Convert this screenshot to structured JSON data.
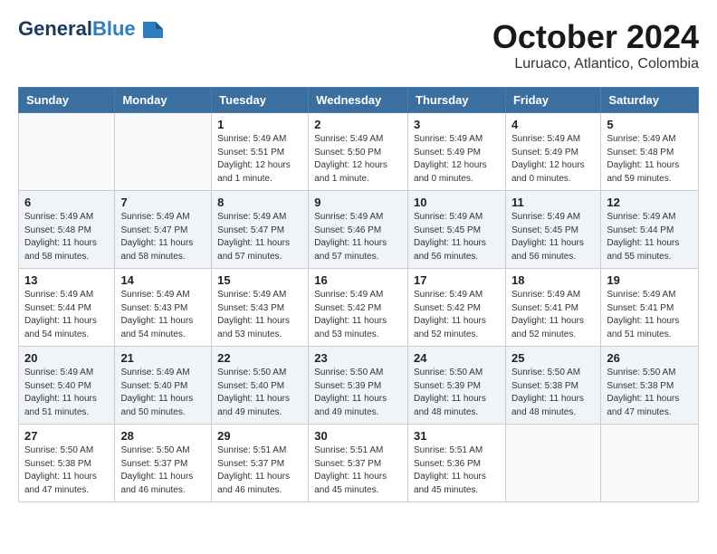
{
  "header": {
    "logo_line1": "General",
    "logo_line2": "Blue",
    "month": "October 2024",
    "location": "Luruaco, Atlantico, Colombia"
  },
  "weekdays": [
    "Sunday",
    "Monday",
    "Tuesday",
    "Wednesday",
    "Thursday",
    "Friday",
    "Saturday"
  ],
  "weeks": [
    [
      {
        "day": "",
        "info": ""
      },
      {
        "day": "",
        "info": ""
      },
      {
        "day": "1",
        "info": "Sunrise: 5:49 AM\nSunset: 5:51 PM\nDaylight: 12 hours\nand 1 minute."
      },
      {
        "day": "2",
        "info": "Sunrise: 5:49 AM\nSunset: 5:50 PM\nDaylight: 12 hours\nand 1 minute."
      },
      {
        "day": "3",
        "info": "Sunrise: 5:49 AM\nSunset: 5:49 PM\nDaylight: 12 hours\nand 0 minutes."
      },
      {
        "day": "4",
        "info": "Sunrise: 5:49 AM\nSunset: 5:49 PM\nDaylight: 12 hours\nand 0 minutes."
      },
      {
        "day": "5",
        "info": "Sunrise: 5:49 AM\nSunset: 5:48 PM\nDaylight: 11 hours\nand 59 minutes."
      }
    ],
    [
      {
        "day": "6",
        "info": "Sunrise: 5:49 AM\nSunset: 5:48 PM\nDaylight: 11 hours\nand 58 minutes."
      },
      {
        "day": "7",
        "info": "Sunrise: 5:49 AM\nSunset: 5:47 PM\nDaylight: 11 hours\nand 58 minutes."
      },
      {
        "day": "8",
        "info": "Sunrise: 5:49 AM\nSunset: 5:47 PM\nDaylight: 11 hours\nand 57 minutes."
      },
      {
        "day": "9",
        "info": "Sunrise: 5:49 AM\nSunset: 5:46 PM\nDaylight: 11 hours\nand 57 minutes."
      },
      {
        "day": "10",
        "info": "Sunrise: 5:49 AM\nSunset: 5:45 PM\nDaylight: 11 hours\nand 56 minutes."
      },
      {
        "day": "11",
        "info": "Sunrise: 5:49 AM\nSunset: 5:45 PM\nDaylight: 11 hours\nand 56 minutes."
      },
      {
        "day": "12",
        "info": "Sunrise: 5:49 AM\nSunset: 5:44 PM\nDaylight: 11 hours\nand 55 minutes."
      }
    ],
    [
      {
        "day": "13",
        "info": "Sunrise: 5:49 AM\nSunset: 5:44 PM\nDaylight: 11 hours\nand 54 minutes."
      },
      {
        "day": "14",
        "info": "Sunrise: 5:49 AM\nSunset: 5:43 PM\nDaylight: 11 hours\nand 54 minutes."
      },
      {
        "day": "15",
        "info": "Sunrise: 5:49 AM\nSunset: 5:43 PM\nDaylight: 11 hours\nand 53 minutes."
      },
      {
        "day": "16",
        "info": "Sunrise: 5:49 AM\nSunset: 5:42 PM\nDaylight: 11 hours\nand 53 minutes."
      },
      {
        "day": "17",
        "info": "Sunrise: 5:49 AM\nSunset: 5:42 PM\nDaylight: 11 hours\nand 52 minutes."
      },
      {
        "day": "18",
        "info": "Sunrise: 5:49 AM\nSunset: 5:41 PM\nDaylight: 11 hours\nand 52 minutes."
      },
      {
        "day": "19",
        "info": "Sunrise: 5:49 AM\nSunset: 5:41 PM\nDaylight: 11 hours\nand 51 minutes."
      }
    ],
    [
      {
        "day": "20",
        "info": "Sunrise: 5:49 AM\nSunset: 5:40 PM\nDaylight: 11 hours\nand 51 minutes."
      },
      {
        "day": "21",
        "info": "Sunrise: 5:49 AM\nSunset: 5:40 PM\nDaylight: 11 hours\nand 50 minutes."
      },
      {
        "day": "22",
        "info": "Sunrise: 5:50 AM\nSunset: 5:40 PM\nDaylight: 11 hours\nand 49 minutes."
      },
      {
        "day": "23",
        "info": "Sunrise: 5:50 AM\nSunset: 5:39 PM\nDaylight: 11 hours\nand 49 minutes."
      },
      {
        "day": "24",
        "info": "Sunrise: 5:50 AM\nSunset: 5:39 PM\nDaylight: 11 hours\nand 48 minutes."
      },
      {
        "day": "25",
        "info": "Sunrise: 5:50 AM\nSunset: 5:38 PM\nDaylight: 11 hours\nand 48 minutes."
      },
      {
        "day": "26",
        "info": "Sunrise: 5:50 AM\nSunset: 5:38 PM\nDaylight: 11 hours\nand 47 minutes."
      }
    ],
    [
      {
        "day": "27",
        "info": "Sunrise: 5:50 AM\nSunset: 5:38 PM\nDaylight: 11 hours\nand 47 minutes."
      },
      {
        "day": "28",
        "info": "Sunrise: 5:50 AM\nSunset: 5:37 PM\nDaylight: 11 hours\nand 46 minutes."
      },
      {
        "day": "29",
        "info": "Sunrise: 5:51 AM\nSunset: 5:37 PM\nDaylight: 11 hours\nand 46 minutes."
      },
      {
        "day": "30",
        "info": "Sunrise: 5:51 AM\nSunset: 5:37 PM\nDaylight: 11 hours\nand 45 minutes."
      },
      {
        "day": "31",
        "info": "Sunrise: 5:51 AM\nSunset: 5:36 PM\nDaylight: 11 hours\nand 45 minutes."
      },
      {
        "day": "",
        "info": ""
      },
      {
        "day": "",
        "info": ""
      }
    ]
  ]
}
